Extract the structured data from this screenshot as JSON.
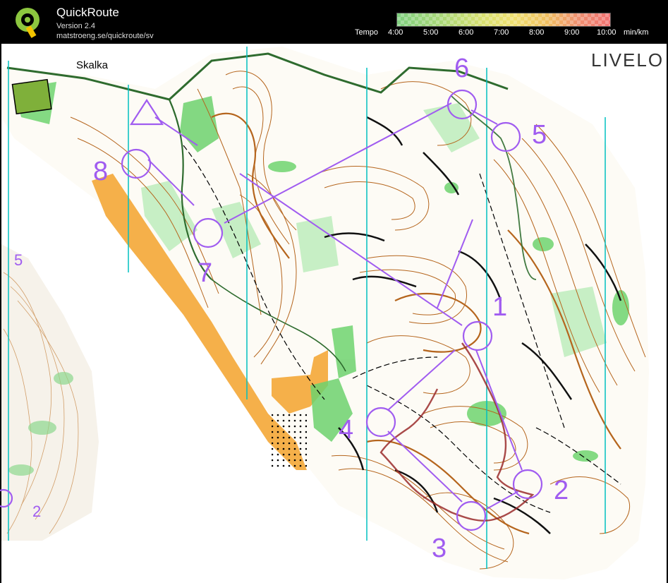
{
  "app": {
    "title": "QuickRoute",
    "version": "Version 2.4",
    "url": "matstroeng.se/quickroute/sv"
  },
  "tempo": {
    "label": "Tempo",
    "ticks": [
      "4:00",
      "5:00",
      "6:00",
      "7:00",
      "8:00",
      "9:00",
      "10:00"
    ],
    "unit": "min/km"
  },
  "map": {
    "place_label": "Skalka",
    "sponsor_label": "LIVELO",
    "controls": [
      "1",
      "2",
      "3",
      "4",
      "5",
      "6",
      "7",
      "8"
    ],
    "adjacent_controls": [
      "5",
      "2"
    ]
  },
  "colors": {
    "course": "#a05cf0",
    "contour": "#b5651d",
    "route": "#9a2a2a",
    "forest_green": "#6ed36e",
    "open_yellow": "#f5b04a",
    "magnetic_north": "#00c0c0"
  }
}
